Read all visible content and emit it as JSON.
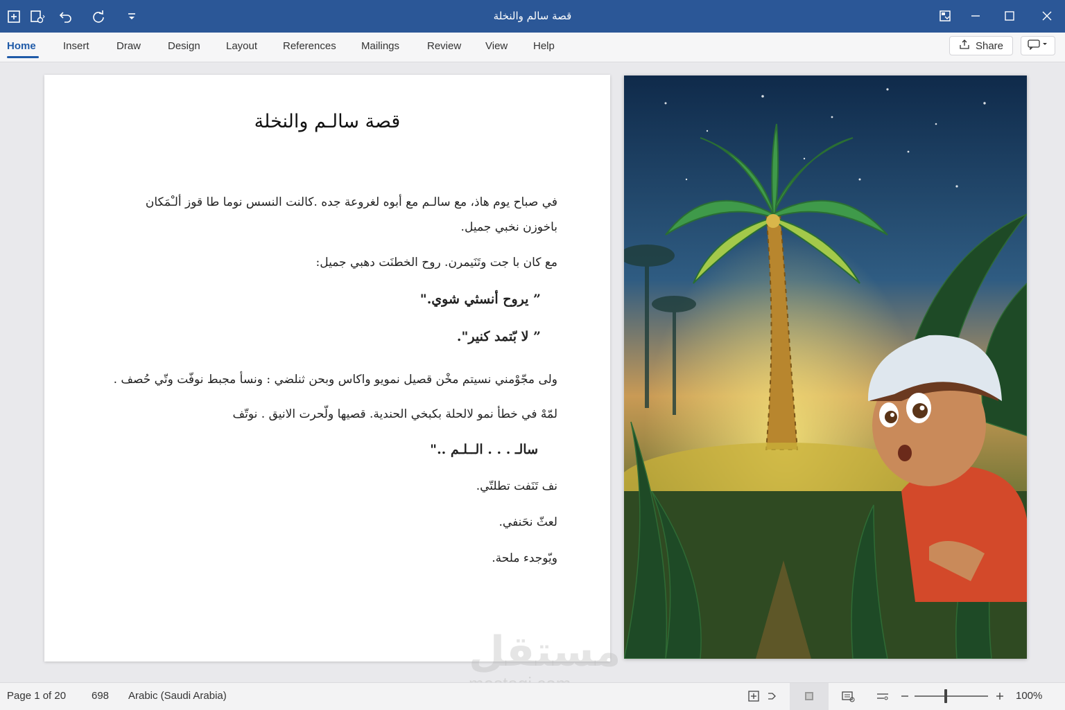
{
  "window": {
    "title": "قصة سالم والنخلة"
  },
  "ribbon": {
    "tabs": [
      "Home",
      "Insert",
      "Draw",
      "Design",
      "Layout",
      "References",
      "Mailings",
      "Review",
      "View",
      "Help"
    ],
    "active_tab": "Home",
    "share_label": "Share"
  },
  "document": {
    "title": "قصة سالـم والنخلة",
    "paragraphs": [
      "في صباح يوم هاذ، مع سالـم مع أبوه لغروعة جده .كالنت النسس نوما طا قوز ألـْمَكان",
      "باخوزن نخبي جميل.",
      "مع كان با جت وتَنَيمرن. روح الخطنَت دهبي جميل:",
      "” يروح أنسثي شوي.\"",
      "” لا بّتمد كنير\".",
      "ولى مجّوْمني نسيتم مخْن قصيل نمويو واكاس وبحن ثنلضي : ونسأ مجبط نوفّت وتّي حُصف .",
      "لمّهْ في خطأ نمو لالحلة بكبخي الحندية. قصيها ولّحرت الانيق . نوتّف",
      "سالـ . . . الــلـم ..\"",
      "نف تَنَفت تطلتّي.",
      "لعثّ نحَنفي.",
      "ويّوجدء ملحة."
    ]
  },
  "watermark": {
    "arabic": "مستقل",
    "latin": "mostaqi.com"
  },
  "statusbar": {
    "page": "Page 1 of 20",
    "words": "698",
    "language": "Arabic (Saudi Arabia)",
    "zoom": "100%",
    "zoom_level": 1.0
  },
  "colors": {
    "titlebar": "#2b5797",
    "accent": "#1f5aa8"
  },
  "icons": [
    "new-doc-icon",
    "save-icon",
    "undo-icon",
    "redo-icon",
    "customize-icon",
    "ribbon-display-icon",
    "minimize-icon",
    "maximize-icon",
    "close-icon",
    "share-icon",
    "comment-icon",
    "focus-icon",
    "read-mode-icon",
    "print-layout-icon",
    "web-layout-icon",
    "zoom-out-icon",
    "zoom-in-icon"
  ]
}
